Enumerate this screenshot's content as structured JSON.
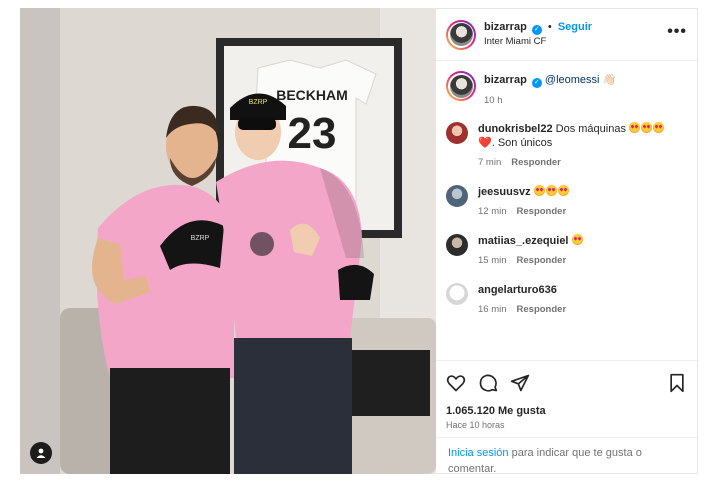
{
  "post": {
    "author": "bizarrap",
    "follow_label": "Seguir",
    "separator": "•",
    "location": "Inter Miami CF",
    "more_label": "•••",
    "photo": {
      "jersey_name": "BECKHAM",
      "jersey_number": "23",
      "cap_text": "BZRP"
    }
  },
  "caption": {
    "author": "bizarrap",
    "mention": "@leomessi",
    "emoji": "👋🏻",
    "time": "10 h"
  },
  "comments": [
    {
      "user": "dunokrisbel22",
      "text": "Dos máquinas",
      "emoji_count": 3,
      "extra_heart": "❤️",
      "extra_text": ". Son únicos",
      "time": "7 min",
      "reply": "Responder"
    },
    {
      "user": "jeesuusvz",
      "text": "",
      "emoji_count": 3,
      "time": "12 min",
      "reply": "Responder"
    },
    {
      "user": "matiias_.ezequiel",
      "text": "",
      "emoji_count": 1,
      "time": "15 min",
      "reply": "Responder"
    },
    {
      "user": "angelarturo636",
      "text": "",
      "emoji_count": 0,
      "time": "16 min",
      "reply": "Responder"
    }
  ],
  "actions": {
    "likes": "1.065.120 Me gusta",
    "posted_ago": "Hace 10 horas"
  },
  "login": {
    "link": "Inicia sesión",
    "text": " para indicar que te gusta o comentar."
  },
  "colors": {
    "accent": "#0095f6",
    "pink_jersey": "#f4a7c8",
    "text": "#262626",
    "muted": "#737373"
  }
}
